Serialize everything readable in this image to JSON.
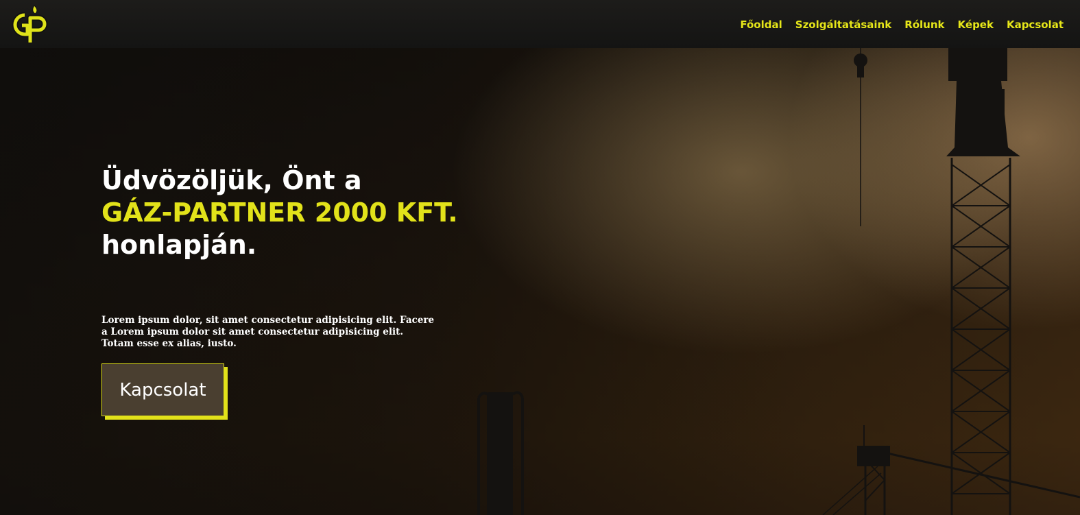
{
  "brand": {
    "logo_text": "GP",
    "accent_color": "#e2e21a",
    "nav_bg": "#161615"
  },
  "nav": {
    "items": [
      {
        "label": "Főoldal"
      },
      {
        "label": "Szolgáltatásaink"
      },
      {
        "label": "Rólunk"
      },
      {
        "label": "Képek"
      },
      {
        "label": "Kapcsolat"
      }
    ]
  },
  "hero": {
    "title_line1": "Üdvözöljük, Önt a",
    "company_name": "GÁZ-PARTNER 2000 KFT.",
    "title_line3": "honlapján.",
    "paragraph": "Lorem ipsum dolor, sit amet consectetur adipisicing elit. Facere a Lorem ipsum dolor sit amet consectetur adipisicing elit. Totam esse ex alias, iusto.",
    "cta_label": "Kapcsolat",
    "background_icon": "construction-cranes-sunset-image"
  }
}
